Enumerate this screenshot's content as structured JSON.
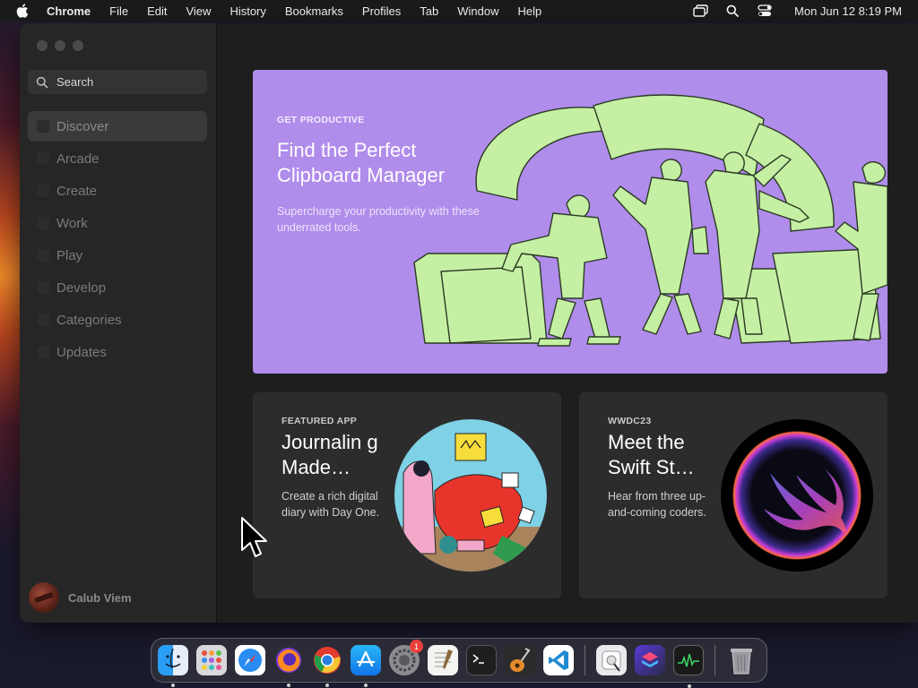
{
  "menubar": {
    "app_name": "Chrome",
    "menus": [
      "File",
      "Edit",
      "View",
      "History",
      "Bookmarks",
      "Profiles",
      "Tab",
      "Window",
      "Help"
    ],
    "clock": "Mon Jun 12  8:19 PM",
    "status_icons": [
      "screen-mirroring-icon",
      "spotlight-search-icon",
      "control-center-icon"
    ]
  },
  "sidebar": {
    "search_placeholder": "Search",
    "items": [
      {
        "label": "Discover",
        "active": true
      },
      {
        "label": "Arcade",
        "active": false
      },
      {
        "label": "Create",
        "active": false
      },
      {
        "label": "Work",
        "active": false
      },
      {
        "label": "Play",
        "active": false
      },
      {
        "label": "Develop",
        "active": false
      },
      {
        "label": "Categories",
        "active": false
      },
      {
        "label": "Updates",
        "active": false
      }
    ],
    "profile_name": "Calub Viem"
  },
  "hero": {
    "eyebrow": "GET PRODUCTIVE",
    "title": "Find the Perfect Clipboard Manager",
    "subtitle": "Supercharge your productivity with these underrated tools.",
    "background_color": "#b08ceb",
    "illustration_color": "#c5f0a4"
  },
  "cards": [
    {
      "eyebrow": "FEATURED APP",
      "title": "Journalin g Made…",
      "description": "Create a rich digital diary with Day One.",
      "art": "journaling-illustration"
    },
    {
      "eyebrow": "WWDC23",
      "title": "Meet the Swift St…",
      "description": "Hear from three up-and-coming coders.",
      "art": "swift-logo-orb"
    }
  ],
  "dock": {
    "apps": [
      {
        "name": "finder-icon",
        "running": true
      },
      {
        "name": "launchpad-icon",
        "running": false
      },
      {
        "name": "safari-icon",
        "running": false
      },
      {
        "name": "firefox-icon",
        "running": true
      },
      {
        "name": "chrome-icon",
        "running": true
      },
      {
        "name": "app-store-icon",
        "running": true
      },
      {
        "name": "system-settings-icon",
        "running": false,
        "badge": "1"
      },
      {
        "name": "textedit-icon",
        "running": false
      },
      {
        "name": "terminal-icon",
        "running": false
      },
      {
        "name": "garageband-icon",
        "running": false
      },
      {
        "name": "vscode-icon",
        "running": false
      }
    ],
    "recent_apps": [
      {
        "name": "disk-utility-icon",
        "running": false
      },
      {
        "name": "shortcuts-icon",
        "running": false
      },
      {
        "name": "activity-monitor-icon",
        "running": true
      }
    ],
    "trash": "trash-icon"
  }
}
